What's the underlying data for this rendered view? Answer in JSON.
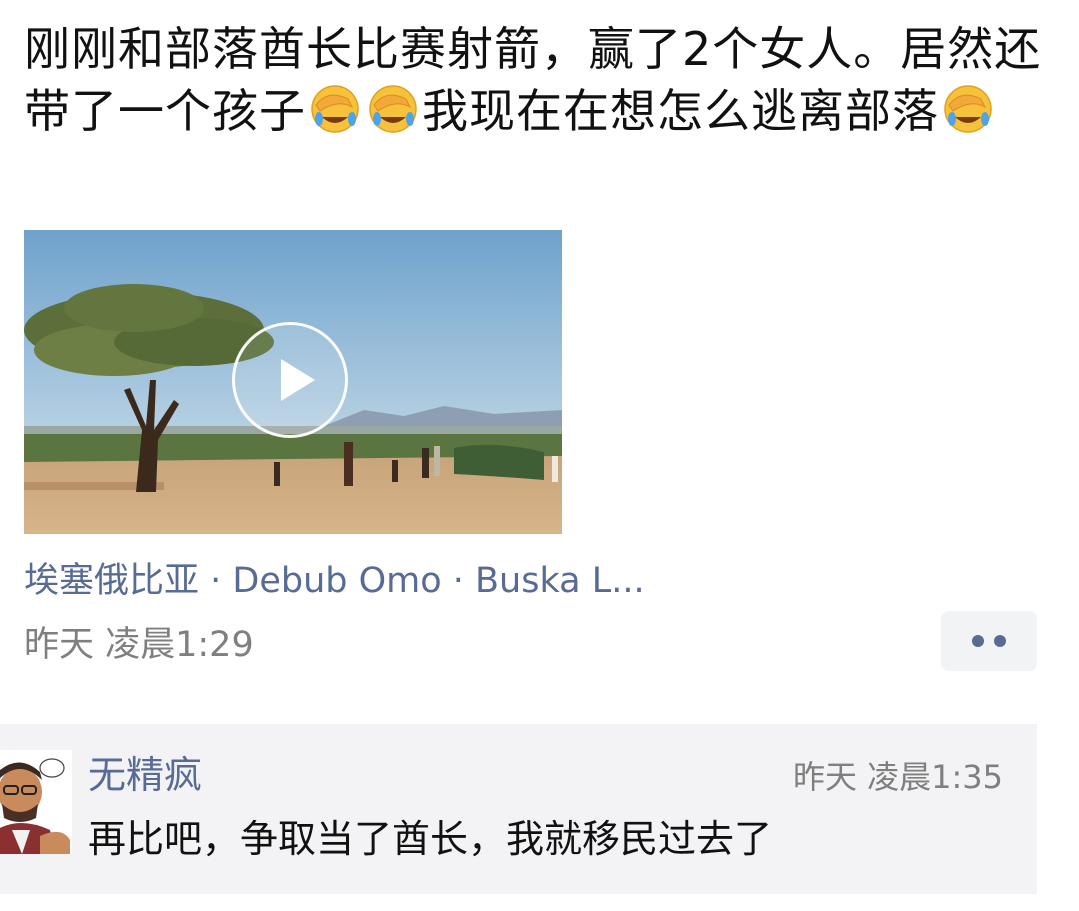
{
  "post": {
    "text_part1": "刚刚和部落酋长比赛射箭，赢了2个女人。居然还带了一个孩子",
    "text_part2": "我现在在想怎么逃离部落",
    "emojis": [
      "face-with-hand-over-eyes-crying-emoji",
      "face-with-hand-over-eyes-crying-emoji",
      "face-with-hand-over-eyes-crying-emoji"
    ],
    "video": {
      "icon": "play-icon"
    },
    "location": "埃塞俄比亚 · Debub Omo · Buska L...",
    "timestamp": "昨天  凌晨1:29",
    "more_icon": "more-dots-icon"
  },
  "comment": {
    "author": "无精疯",
    "time": "昨天  凌晨1:35",
    "text": "再比吧，争取当了酋长，我就移民过去了"
  },
  "colors": {
    "link": "#576b95",
    "meta": "#7f7f7f",
    "text": "#111111",
    "comment_bg": "#f3f3f5"
  }
}
